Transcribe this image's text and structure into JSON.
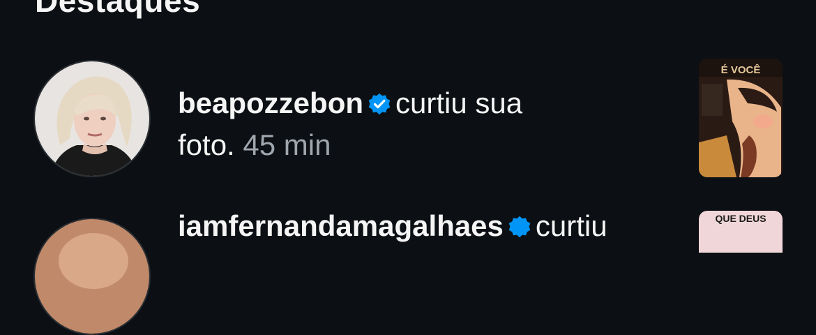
{
  "section": {
    "title": "Destaques"
  },
  "notifications": [
    {
      "username": "beapozzebon",
      "action": "curtiu sua",
      "action_cont": "foto.",
      "time": "45 min",
      "thumbnail_caption": "É VOCÊ"
    },
    {
      "username": "iamfernandamagalhaes",
      "action": "curtiu",
      "thumbnail_caption": "QUE DEUS"
    }
  ],
  "colors": {
    "background": "#0c1014",
    "verified": "#0095f6",
    "muted_text": "#a0a6ad"
  }
}
